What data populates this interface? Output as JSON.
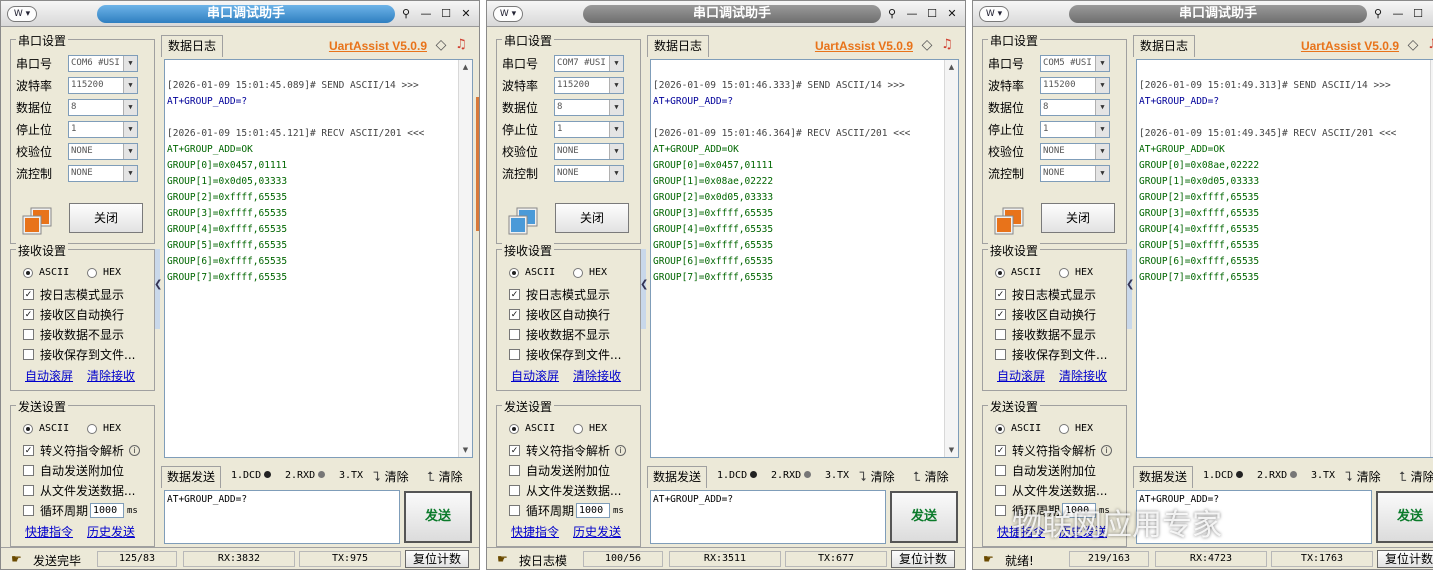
{
  "labels": {
    "title": "串口调试助手",
    "serial_settings": "串口设置",
    "port": "串口号",
    "baud": "波特率",
    "databits": "数据位",
    "stopbits": "停止位",
    "parity": "校验位",
    "flow": "流控制",
    "close": "关闭",
    "recv_settings": "接收设置",
    "send_settings": "发送设置",
    "ascii": "ASCII",
    "hex": "HEX",
    "log_mode": "按日志模式显示",
    "auto_wrap": "接收区自动换行",
    "hide_recv": "接收数据不显示",
    "save_file": "接收保存到文件...",
    "auto_scroll": "自动滚屏",
    "clear_recv": "清除接收",
    "escape": "转义符指令解析",
    "auto_append": "自动发送附加位",
    "file_send": "从文件发送数据...",
    "cycle": "循环周期",
    "cycle_value": "1000",
    "ms": "ms",
    "shortcut": "快捷指令",
    "history": "历史发送",
    "log_tab": "数据日志",
    "version": "UartAssist V5.0.9",
    "send_tab": "数据发送",
    "dcd": "1.DCD",
    "rxd": "2.RXD",
    "tx": "3.TX",
    "clear": "清除",
    "send": "发送",
    "reset": "复位计数",
    "watermark": "物联网应用专家"
  },
  "icons": {
    "sysmenu": "sysmenu-icon",
    "pin": "pin-icon",
    "minimize": "minimize-icon",
    "maximize": "maximize-icon",
    "close": "close-icon",
    "gem": "gem-icon",
    "bell": "bell-icon",
    "port": "port-status-icon",
    "clear": "clear-icon",
    "info": "info-icon",
    "status": "status-hand-icon"
  },
  "colors": {
    "accent_orange": "#e8731a",
    "send_blue": "#000099",
    "recv_green": "#006600",
    "send_button": "#0a7a2a",
    "link_blue": "#0000cc"
  },
  "windows": [
    {
      "title_active": true,
      "port": "COM6 #USI",
      "baud": "115200",
      "databits": "8",
      "stopbits": "1",
      "parity": "NONE",
      "flow": "NONE",
      "log": [
        {
          "t": "ts",
          "text": "[2026-01-09 15:01:45.089]# SEND ASCII/14 >>>"
        },
        {
          "t": "send",
          "text": "AT+GROUP_ADD=?"
        },
        {
          "t": "blank",
          "text": ""
        },
        {
          "t": "ts",
          "text": "[2026-01-09 15:01:45.121]# RECV ASCII/201 <<<"
        },
        {
          "t": "recv",
          "text": "AT+GROUP_ADD=OK"
        },
        {
          "t": "recv",
          "text": "GROUP[0]=0x0457,01111"
        },
        {
          "t": "recv",
          "text": "GROUP[1]=0x0d05,03333"
        },
        {
          "t": "recv",
          "text": "GROUP[2]=0xffff,65535"
        },
        {
          "t": "recv",
          "text": "GROUP[3]=0xffff,65535"
        },
        {
          "t": "recv",
          "text": "GROUP[4]=0xffff,65535"
        },
        {
          "t": "recv",
          "text": "GROUP[5]=0xffff,65535"
        },
        {
          "t": "recv",
          "text": "GROUP[6]=0xffff,65535"
        },
        {
          "t": "recv",
          "text": "GROUP[7]=0xffff,65535"
        }
      ],
      "send_text": "AT+GROUP_ADD=?",
      "status": "发送完毕",
      "count": "125/83",
      "rx": "RX:3832",
      "tx": "TX:975"
    },
    {
      "title_active": false,
      "port": "COM7 #USI",
      "baud": "115200",
      "databits": "8",
      "stopbits": "1",
      "parity": "NONE",
      "flow": "NONE",
      "log": [
        {
          "t": "ts",
          "text": "[2026-01-09 15:01:46.333]# SEND ASCII/14 >>>"
        },
        {
          "t": "send",
          "text": "AT+GROUP_ADD=?"
        },
        {
          "t": "blank",
          "text": ""
        },
        {
          "t": "ts",
          "text": "[2026-01-09 15:01:46.364]# RECV ASCII/201 <<<"
        },
        {
          "t": "recv",
          "text": "AT+GROUP_ADD=OK"
        },
        {
          "t": "recv",
          "text": "GROUP[0]=0x0457,01111"
        },
        {
          "t": "recv",
          "text": "GROUP[1]=0x08ae,02222"
        },
        {
          "t": "recv",
          "text": "GROUP[2]=0x0d05,03333"
        },
        {
          "t": "recv",
          "text": "GROUP[3]=0xffff,65535"
        },
        {
          "t": "recv",
          "text": "GROUP[4]=0xffff,65535"
        },
        {
          "t": "recv",
          "text": "GROUP[5]=0xffff,65535"
        },
        {
          "t": "recv",
          "text": "GROUP[6]=0xffff,65535"
        },
        {
          "t": "recv",
          "text": "GROUP[7]=0xffff,65535"
        }
      ],
      "send_text": "AT+GROUP_ADD=?",
      "status": "按日志模",
      "count": "100/56",
      "rx": "RX:3511",
      "tx": "TX:677"
    },
    {
      "title_active": false,
      "port": "COM5 #USI",
      "baud": "115200",
      "databits": "8",
      "stopbits": "1",
      "parity": "NONE",
      "flow": "NONE",
      "log": [
        {
          "t": "ts",
          "text": "[2026-01-09 15:01:49.313]# SEND ASCII/14 >>>"
        },
        {
          "t": "send",
          "text": "AT+GROUP_ADD=?"
        },
        {
          "t": "blank",
          "text": ""
        },
        {
          "t": "ts",
          "text": "[2026-01-09 15:01:49.345]# RECV ASCII/201 <<<"
        },
        {
          "t": "recv",
          "text": "AT+GROUP_ADD=OK"
        },
        {
          "t": "recv",
          "text": "GROUP[0]=0x08ae,02222"
        },
        {
          "t": "recv",
          "text": "GROUP[1]=0x0d05,03333"
        },
        {
          "t": "recv",
          "text": "GROUP[2]=0xffff,65535"
        },
        {
          "t": "recv",
          "text": "GROUP[3]=0xffff,65535"
        },
        {
          "t": "recv",
          "text": "GROUP[4]=0xffff,65535"
        },
        {
          "t": "recv",
          "text": "GROUP[5]=0xffff,65535"
        },
        {
          "t": "recv",
          "text": "GROUP[6]=0xffff,65535"
        },
        {
          "t": "recv",
          "text": "GROUP[7]=0xffff,65535"
        }
      ],
      "send_text": "AT+GROUP_ADD=?",
      "status": "就绪!",
      "count": "219/163",
      "rx": "RX:4723",
      "tx": "TX:1763"
    }
  ]
}
